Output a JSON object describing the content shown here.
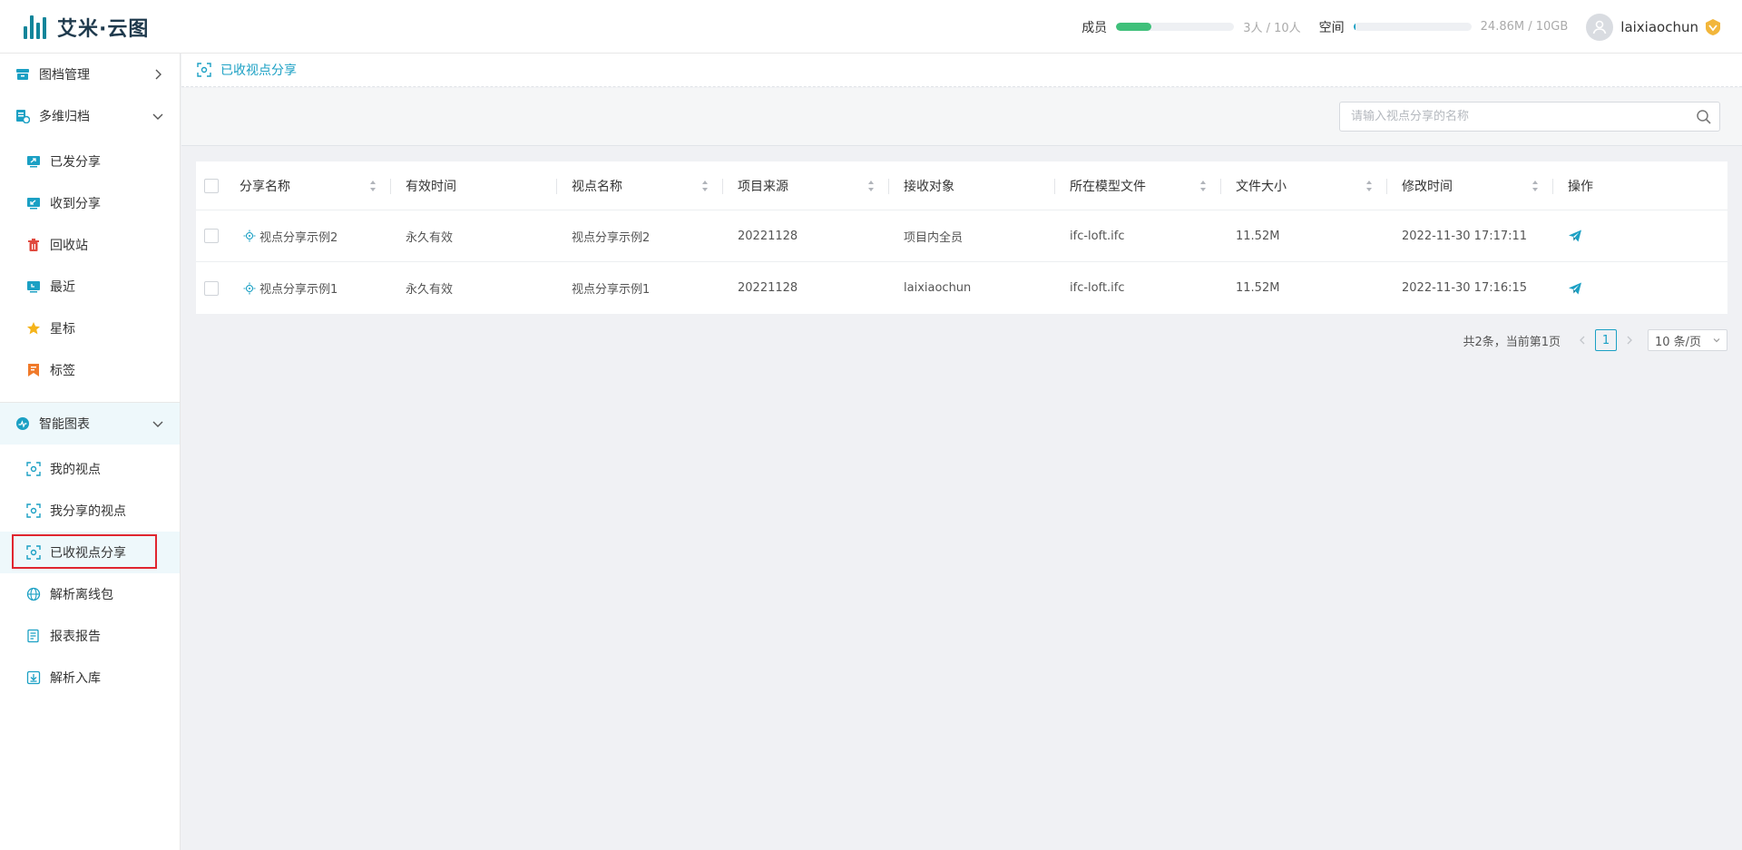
{
  "app": {
    "logo_text": "艾米·云图"
  },
  "header": {
    "members_label": "成员",
    "members_value": "3人 / 10人",
    "members_fraction": 0.3,
    "space_label": "空间",
    "space_value": "24.86M / 10GB",
    "space_fraction": 0.01,
    "username": "laixiaochun",
    "colors": {
      "member_bar": "#3fc07a",
      "space_bar": "#1ba0c4"
    }
  },
  "sidebar": {
    "groups": [
      {
        "label": "图档管理",
        "icon": "archive-icon",
        "expanded": false
      },
      {
        "label": "多维归档",
        "icon": "multi-archive-icon",
        "expanded": true,
        "items": [
          {
            "label": "已发分享",
            "icon": "sent-share-icon"
          },
          {
            "label": "收到分享",
            "icon": "received-share-icon"
          },
          {
            "label": "回收站",
            "icon": "trash-icon"
          },
          {
            "label": "最近",
            "icon": "recent-icon"
          },
          {
            "label": "星标",
            "icon": "star-icon"
          },
          {
            "label": "标签",
            "icon": "tag-icon"
          }
        ]
      },
      {
        "label": "智能图表",
        "icon": "smart-chart-icon",
        "expanded": true,
        "items": [
          {
            "label": "我的视点",
            "icon": "viewpoint-icon"
          },
          {
            "label": "我分享的视点",
            "icon": "viewpoint-icon"
          },
          {
            "label": "已收视点分享",
            "icon": "viewpoint-icon",
            "selected": true
          },
          {
            "label": "解析离线包",
            "icon": "globe-icon"
          },
          {
            "label": "报表报告",
            "icon": "report-icon"
          },
          {
            "label": "解析入库",
            "icon": "import-icon"
          }
        ]
      }
    ]
  },
  "breadcrumb": {
    "label": "已收视点分享"
  },
  "search": {
    "placeholder": "请输入视点分享的名称",
    "value": ""
  },
  "table": {
    "columns": [
      "分享名称",
      "有效时间",
      "视点名称",
      "项目来源",
      "接收对象",
      "所在模型文件",
      "文件大小",
      "修改时间",
      "操作"
    ],
    "rows": [
      {
        "share_name": "视点分享示例2",
        "validity": "永久有效",
        "viewpoint_name": "视点分享示例2",
        "project_source": "20221128",
        "recipient": "项目内全员",
        "model_file": "ifc-loft.ifc",
        "file_size": "11.52M",
        "modified": "2022-11-30 17:17:11"
      },
      {
        "share_name": "视点分享示例1",
        "validity": "永久有效",
        "viewpoint_name": "视点分享示例1",
        "project_source": "20221128",
        "recipient": "laixiaochun",
        "model_file": "ifc-loft.ifc",
        "file_size": "11.52M",
        "modified": "2022-11-30 17:16:15"
      }
    ]
  },
  "pagination": {
    "summary": "共2条，当前第1页",
    "current_page": "1",
    "page_size": "10 条/页"
  }
}
